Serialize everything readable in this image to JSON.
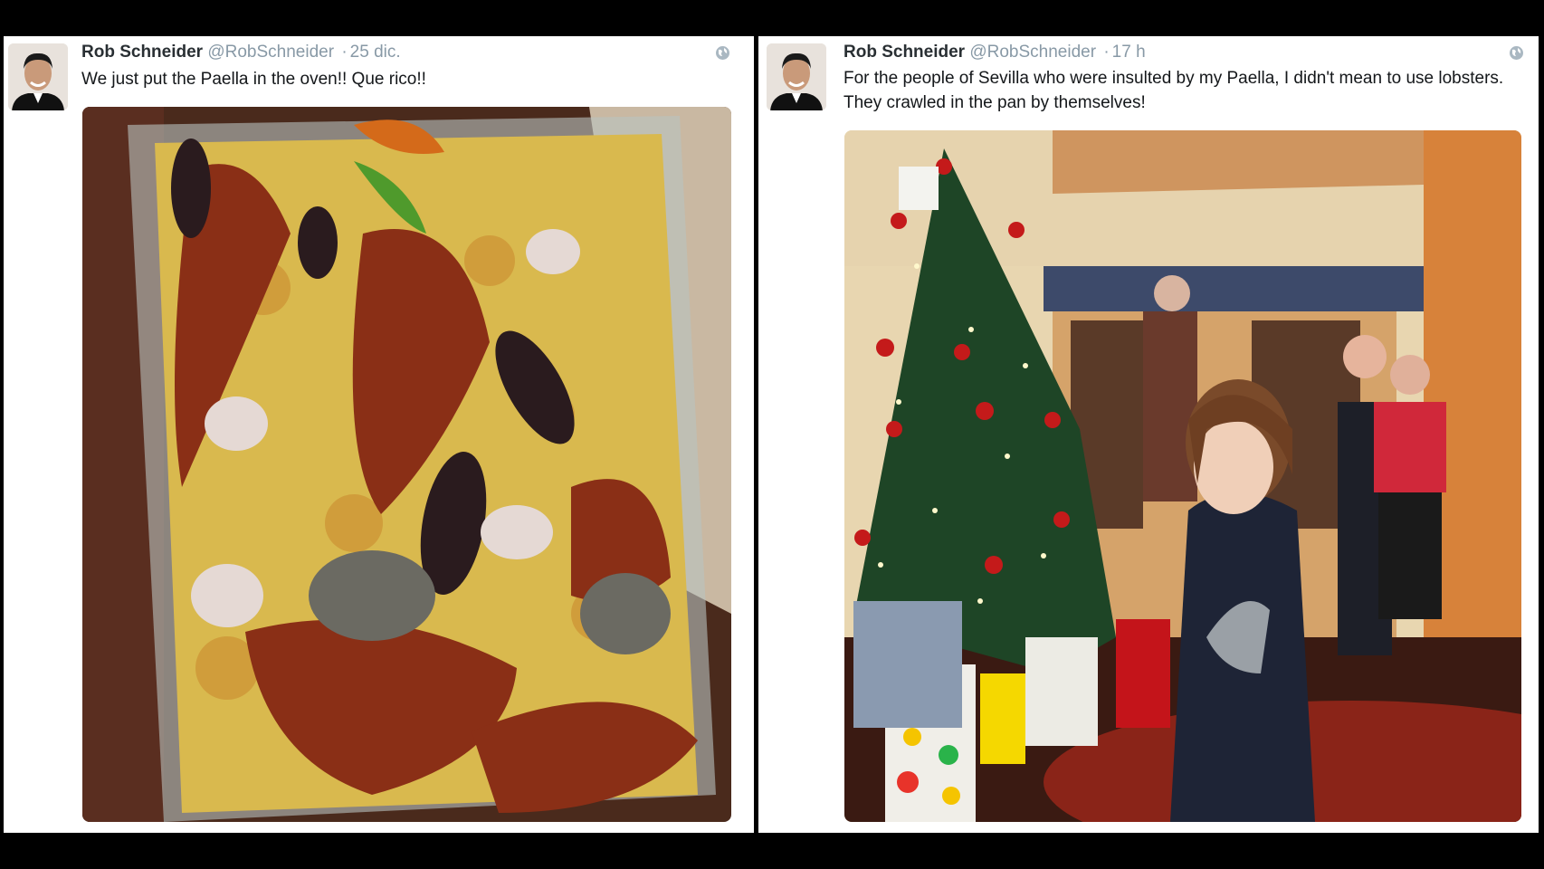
{
  "tweets": [
    {
      "name": "Rob Schneider",
      "handle": "@RobSchneider",
      "separator": "·",
      "time": "25 dic.",
      "text": "We just put the Paella in the oven!! Que rico!!",
      "avatar_icon": "profile-photo",
      "globe_icon": "globe-icon",
      "photo_subject": "paella-with-lobster-photo"
    },
    {
      "name": "Rob Schneider",
      "handle": "@RobSchneider",
      "separator": "·",
      "time": "17 h",
      "text": "For the people of Sevilla who were insulted by my Paella, I didn't mean to use lobsters. They crawled in the pan by themselves!",
      "avatar_icon": "profile-photo",
      "globe_icon": "globe-icon",
      "photo_subject": "christmas-tree-family-photo"
    }
  ],
  "colors": {
    "background": "#000000",
    "card": "#ffffff",
    "name": "#292f33",
    "meta": "#8899a6",
    "text": "#14171a"
  }
}
